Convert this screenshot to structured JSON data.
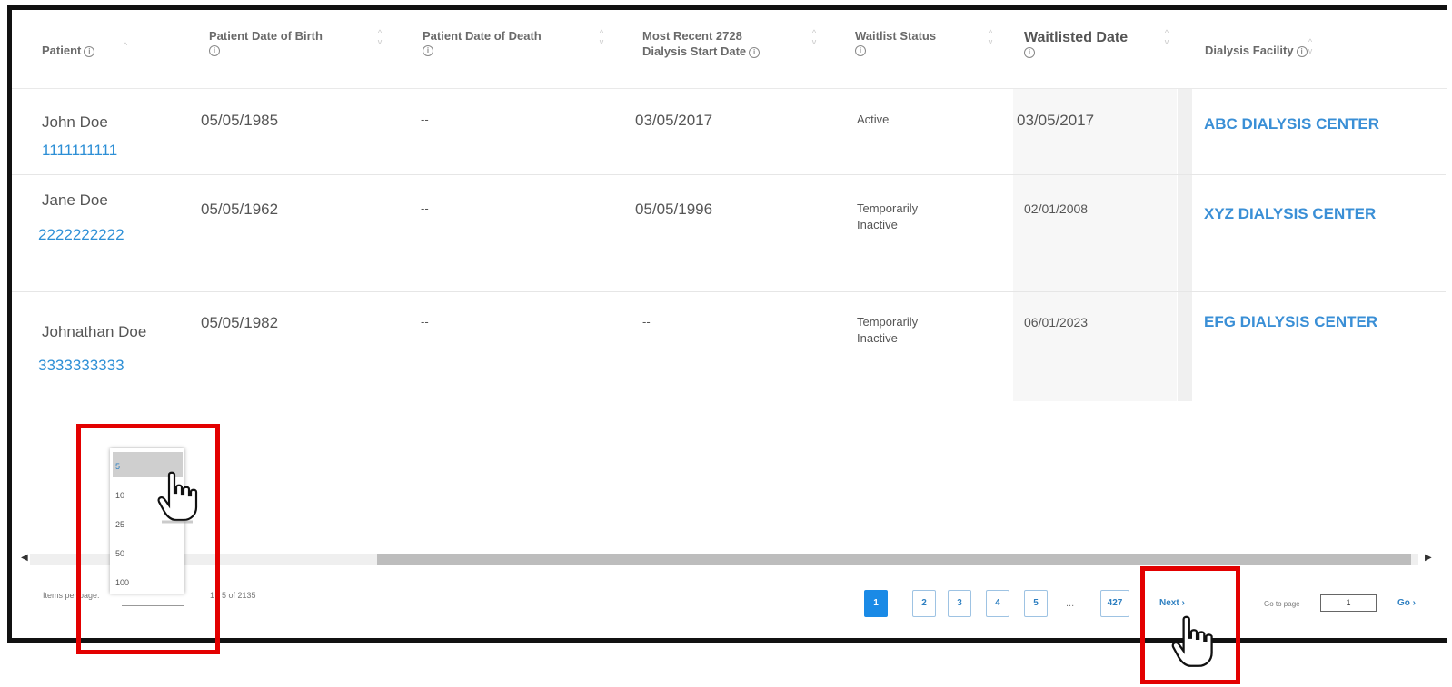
{
  "table": {
    "columns": [
      {
        "label": "Patient"
      },
      {
        "label": "Patient Date of Birth"
      },
      {
        "label": "Patient Date of Death"
      },
      {
        "label": "Most Recent 2728 Dialysis Start Date",
        "line1": "Most Recent 2728",
        "line2": "Dialysis Start Date"
      },
      {
        "label": "Waitlist Status"
      },
      {
        "label": "Waitlisted Date"
      },
      {
        "label": "Dialysis Facility"
      }
    ],
    "rows": [
      {
        "name": "John Doe",
        "id": "1111111111",
        "dob": "05/05/1985",
        "dod": "--",
        "dialysis_start": "03/05/2017",
        "status": "Active",
        "status2": "",
        "waitlisted": "03/05/2017",
        "facility": "ABC DIALYSIS CENTER"
      },
      {
        "name": "Jane Doe",
        "id": "2222222222",
        "dob": "05/05/1962",
        "dod": "--",
        "dialysis_start": "05/05/1996",
        "status": "Temporarily",
        "status2": "Inactive",
        "waitlisted": "02/01/2008",
        "facility": "XYZ DIALYSIS CENTER"
      },
      {
        "name": "Johnathan Doe",
        "id": "3333333333",
        "dob": "05/05/1982",
        "dod": "--",
        "dialysis_start": "--",
        "status": "Temporarily",
        "status2": "Inactive",
        "waitlisted": "06/01/2023",
        "facility": "EFG DIALYSIS CENTER"
      }
    ]
  },
  "items_per_page": {
    "label": "Items per page:",
    "options": [
      "5",
      "10",
      "25",
      "50",
      "100"
    ],
    "selected": "5",
    "range_text": "1 - 5 of 2135"
  },
  "pagination": {
    "pages": [
      "1",
      "2",
      "3",
      "4",
      "5"
    ],
    "ellipsis": "...",
    "last_page": "427",
    "next_label": "Next",
    "goto_label": "Go to page",
    "goto_value": "1",
    "go_label": "Go"
  },
  "colors": {
    "highlight": "#e30000",
    "link": "#2d8fd6",
    "active_page": "#1a8ae6"
  },
  "icons": [
    "info-icon",
    "sort-icon",
    "hand-pointer-icon",
    "scroll-left-icon",
    "scroll-right-icon"
  ]
}
